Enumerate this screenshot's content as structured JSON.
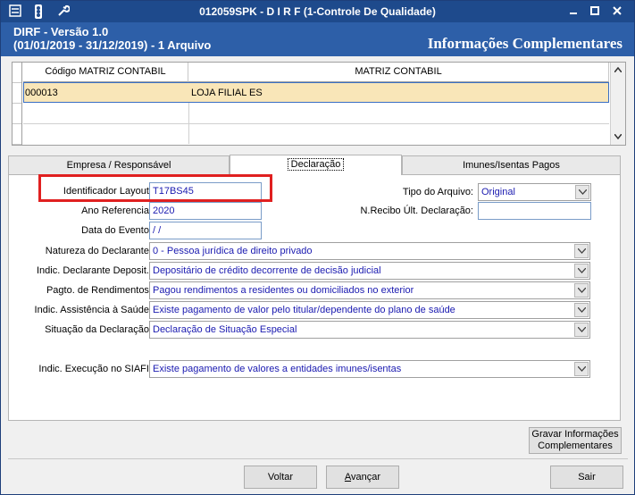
{
  "window": {
    "title": "012059SPK - D I R F (1-Controle De Qualidade)",
    "title_icons": [
      "menu-icon",
      "traffic-light-icon",
      "wrench-icon"
    ],
    "controls": [
      "minimize-icon",
      "maximize-icon",
      "close-icon"
    ]
  },
  "header": {
    "app": "DIRF - Versão 1.0",
    "period": "(01/01/2019 - 31/12/2019) - 1 Arquivo",
    "section": "Informações Complementares"
  },
  "grid": {
    "columns": [
      "Código MATRIZ CONTABIL",
      "MATRIZ CONTABIL"
    ],
    "rows": [
      {
        "code": "000013",
        "name": "LOJA FILIAL ES"
      }
    ]
  },
  "tabs": [
    "Empresa / Responsável",
    "Declaração",
    "Imunes/Isentas Pagos"
  ],
  "active_tab": "Declaração",
  "form": {
    "identificador_layout": {
      "label": "Identificador Layout:",
      "value": "T17BS45"
    },
    "ano_referencia": {
      "label": "Ano Referencia:",
      "value": "2020"
    },
    "data_evento": {
      "label": "Data do Evento:",
      "value": " / /"
    },
    "tipo_arquivo": {
      "label": "Tipo do Arquivo:",
      "value": "Original"
    },
    "n_recibo": {
      "label": "N.Recibo Últ. Declaração:",
      "value": ""
    },
    "natureza": {
      "label": "Natureza do Declarante:",
      "value": "0 - Pessoa jurídica de direito privado"
    },
    "indic_depositario": {
      "label": "Indic. Declarante Deposit.:",
      "value": "Depositário de crédito decorrente de decisão judicial"
    },
    "pagto_rendimentos": {
      "label": "Pagto. de Rendimentos:",
      "value": "Pagou rendimentos a residentes ou domiciliados no exterior"
    },
    "indic_saude": {
      "label": "Indic. Assistência à Saúde:",
      "value": "Existe pagamento de valor pelo titular/dependente do plano de saúde"
    },
    "situacao": {
      "label": "Situação da Declaração:",
      "value": "Declaração de Situação Especial"
    },
    "siafi": {
      "label": "Indic. Execução no SIAFI:",
      "value": "Existe pagamento de valores a entidades imunes/isentas"
    }
  },
  "buttons": {
    "gravar_line1": "Gravar Informações",
    "gravar_line2": "Complementares",
    "voltar": "Voltar",
    "avancar_a": "A",
    "avancar_rest": "vançar",
    "sair": "Sair"
  },
  "colors": {
    "titlebar": "#1e4a8c",
    "header": "#2d5fa8",
    "selected_row": "#f9e6b8",
    "value_text": "#1a1ab0",
    "highlight": "#e02020"
  }
}
